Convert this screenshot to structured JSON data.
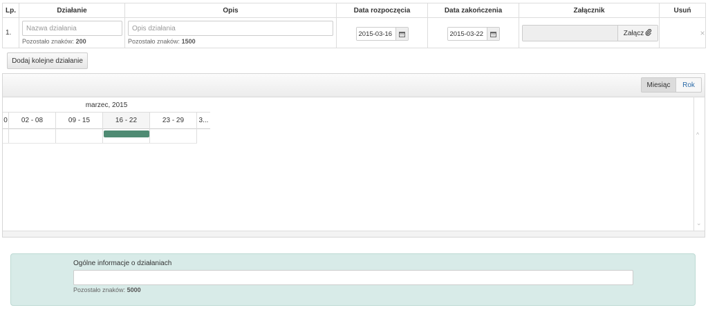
{
  "table": {
    "headers": [
      "Lp.",
      "Działanie",
      "Opis",
      "Data rozpoczęcia",
      "Data zakończenia",
      "Załącznik",
      "Usuń"
    ],
    "row": {
      "lp": "1.",
      "name_placeholder": "Nazwa działania",
      "name_value": "",
      "name_remaining_label": "Pozostało znaków:",
      "name_remaining_count": "200",
      "desc_placeholder": "Opis działania",
      "desc_value": "",
      "desc_remaining_label": "Pozostało znaków:",
      "desc_remaining_count": "1500",
      "start_date": "2015-03-16",
      "end_date": "2015-03-22",
      "attach_label": "Załącz",
      "delete_symbol": "×"
    }
  },
  "add_button": "Dodaj kolejne działanie",
  "gantt": {
    "view_month": "Miesiąc",
    "view_year": "Rok",
    "active_view": "Miesiąc",
    "month_label": "marzec, 2015",
    "weeks": [
      "0",
      "02 - 08",
      "09 - 15",
      "16 - 22",
      "23 - 29",
      "3..."
    ],
    "bar_color": "#4f8b73",
    "bar_week": "16 - 22"
  },
  "general": {
    "label": "Ogólne informacje o działaniach",
    "value": "",
    "remaining_label": "Pozostało znaków:",
    "remaining_count": "5000"
  },
  "colors": {
    "info_bg": "#d8ebe8",
    "link": "#2a6aa8"
  }
}
